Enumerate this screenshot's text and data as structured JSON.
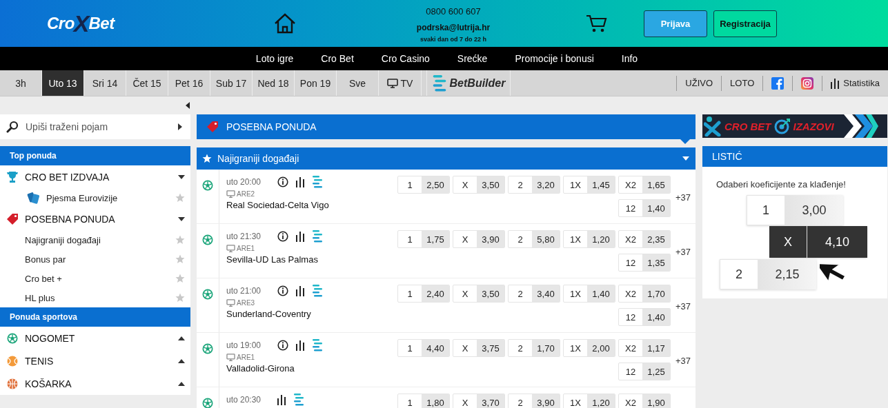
{
  "header": {
    "logo": {
      "text_1": "Cro",
      "mark": "X",
      "text_2": "Bet"
    },
    "phone": "0800 600 607",
    "email": "podrska@lutrija.hr",
    "hours": "svaki dan od 7 do 22 h",
    "buttons": [
      {
        "label": "Prijava",
        "kind": "primary"
      },
      {
        "label": "Registracija",
        "kind": "secondary"
      }
    ]
  },
  "nav": [
    "Loto igre",
    "Cro Bet",
    "Cro Casino",
    "Srećke",
    "Promocije i bonusi",
    "Info"
  ],
  "date_tabs": [
    {
      "label": "3h",
      "selected": false
    },
    {
      "label": "Uto 13",
      "selected": true
    },
    {
      "label": "Sri 14",
      "selected": false
    },
    {
      "label": "Čet 15",
      "selected": false
    },
    {
      "label": "Pet 16",
      "selected": false
    },
    {
      "label": "Sub 17",
      "selected": false
    },
    {
      "label": "Ned 18",
      "selected": false
    },
    {
      "label": "Pon 19",
      "selected": false
    },
    {
      "label": "Sve",
      "selected": false
    }
  ],
  "tv_tab": "TV",
  "betbuilder_tab": "BetBuilder",
  "right_links": [
    {
      "kind": "text",
      "label": "UŽIVO"
    },
    {
      "kind": "text",
      "label": "LOTO"
    },
    {
      "kind": "facebook"
    },
    {
      "kind": "instagram"
    },
    {
      "kind": "stats",
      "label": "Statistika"
    }
  ],
  "sidebar": {
    "search": {
      "placeholder": "Upiši traženi pojam"
    },
    "sections": [
      {
        "title": "Top ponuda",
        "items": [
          {
            "label": "CRO BET IZDVAJA",
            "expanded": true,
            "children": [
              {
                "label": "Pjesma Eurovizije",
                "favorite": false
              }
            ]
          },
          {
            "label": "POSEBNA PONUDA",
            "expanded": true,
            "children": [
              {
                "label": "Najigraniji događaji",
                "favorite": false
              },
              {
                "label": "Bonus par",
                "favorite": false
              },
              {
                "label": "Cro bet +",
                "favorite": false
              },
              {
                "label": "HL plus",
                "favorite": false
              }
            ]
          }
        ]
      },
      {
        "title": "Ponuda sportova",
        "items": [
          {
            "label": "NOGOMET",
            "expanded": false
          },
          {
            "label": "TENIS",
            "expanded": false
          },
          {
            "label": "KOŠARKA",
            "expanded": false
          }
        ]
      }
    ]
  },
  "offer": {
    "title": "POSEBNA PONUDA",
    "group": {
      "title": "Najigraniji događaji",
      "expanded": true
    },
    "events": [
      {
        "time": "uto 20:00",
        "has_info": true,
        "channel": "ARE2",
        "name": "Real Sociedad-Celta Vigo",
        "odds": [
          {
            "label": "1",
            "value": "2,50"
          },
          {
            "label": "X",
            "value": "3,50"
          },
          {
            "label": "2",
            "value": "3,20"
          },
          {
            "label": "1X",
            "value": "1,45"
          },
          {
            "label": "X2",
            "value": "1,65"
          }
        ],
        "odds_extra": [
          {
            "label": "12",
            "value": "1,40"
          }
        ],
        "more": "+37"
      },
      {
        "time": "uto 21:30",
        "has_info": true,
        "channel": "ARE1",
        "name": "Sevilla-UD Las Palmas",
        "odds": [
          {
            "label": "1",
            "value": "1,75"
          },
          {
            "label": "X",
            "value": "3,90"
          },
          {
            "label": "2",
            "value": "5,80"
          },
          {
            "label": "1X",
            "value": "1,20"
          },
          {
            "label": "X2",
            "value": "2,35"
          }
        ],
        "odds_extra": [
          {
            "label": "12",
            "value": "1,35"
          }
        ],
        "more": "+37"
      },
      {
        "time": "uto 21:00",
        "has_info": true,
        "channel": "ARE3",
        "name": "Sunderland-Coventry",
        "odds": [
          {
            "label": "1",
            "value": "2,40"
          },
          {
            "label": "X",
            "value": "3,50"
          },
          {
            "label": "2",
            "value": "3,40"
          },
          {
            "label": "1X",
            "value": "1,40"
          },
          {
            "label": "X2",
            "value": "1,70"
          }
        ],
        "odds_extra": [
          {
            "label": "12",
            "value": "1,40"
          }
        ],
        "more": "+37"
      },
      {
        "time": "uto 19:00",
        "has_info": true,
        "channel": "ARE1",
        "name": "Valladolid-Girona",
        "odds": [
          {
            "label": "1",
            "value": "4,40"
          },
          {
            "label": "X",
            "value": "3,75"
          },
          {
            "label": "2",
            "value": "1,70"
          },
          {
            "label": "1X",
            "value": "2,00"
          },
          {
            "label": "X2",
            "value": "1,17"
          }
        ],
        "odds_extra": [
          {
            "label": "12",
            "value": "1,25"
          }
        ],
        "more": "+37"
      },
      {
        "time": "uto 20:30",
        "has_info": false,
        "odds": [
          {
            "label": "1",
            "value": "1,80"
          },
          {
            "label": "X",
            "value": "3,70"
          },
          {
            "label": "2",
            "value": "3,90"
          },
          {
            "label": "1X",
            "value": "1,20"
          },
          {
            "label": "X2",
            "value": "1,90"
          }
        ]
      }
    ]
  },
  "banner": {
    "text_1": "CRO BET",
    "text_2": "IZAZOVI"
  },
  "slip": {
    "title": "LISTIĆ",
    "hint": "Odaberi koeficijente za klađenje!",
    "sample_odds": [
      {
        "label": "1",
        "value": "3,00",
        "selected": false
      },
      {
        "label": "X",
        "value": "4,10",
        "selected": true
      },
      {
        "label": "2",
        "value": "2,15",
        "selected": false
      }
    ]
  }
}
